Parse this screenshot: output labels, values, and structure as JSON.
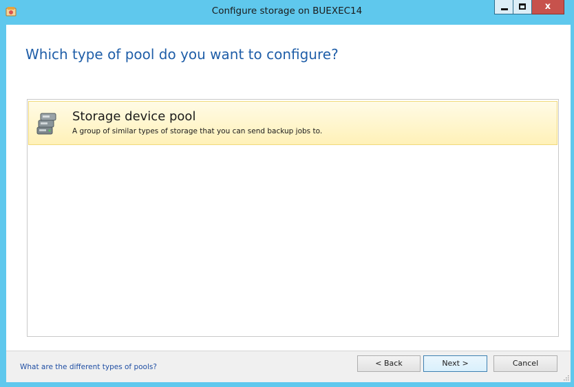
{
  "window": {
    "title": "Configure storage on BUEXEC14",
    "controls": {
      "minimize_icon": "minimize-icon",
      "maximize_icon": "maximize-icon",
      "close_glyph": "x"
    }
  },
  "main": {
    "heading": "Which type of pool do you want to configure?",
    "pool_options": [
      {
        "title": "Storage device pool",
        "description": "A group of similar types of storage that you can send backup jobs to.",
        "icon": "storage-pool-icon",
        "selected": true
      }
    ]
  },
  "footer": {
    "help_link": "What are the different types of pools?",
    "back_label": "< Back",
    "next_label": "Next >",
    "cancel_label": "Cancel"
  },
  "colors": {
    "titlebar": "#5fc8ed",
    "heading": "#1f5ea8",
    "selected_item": "#fff1b8",
    "close_button": "#c7524c",
    "link": "#1f4ea3"
  }
}
